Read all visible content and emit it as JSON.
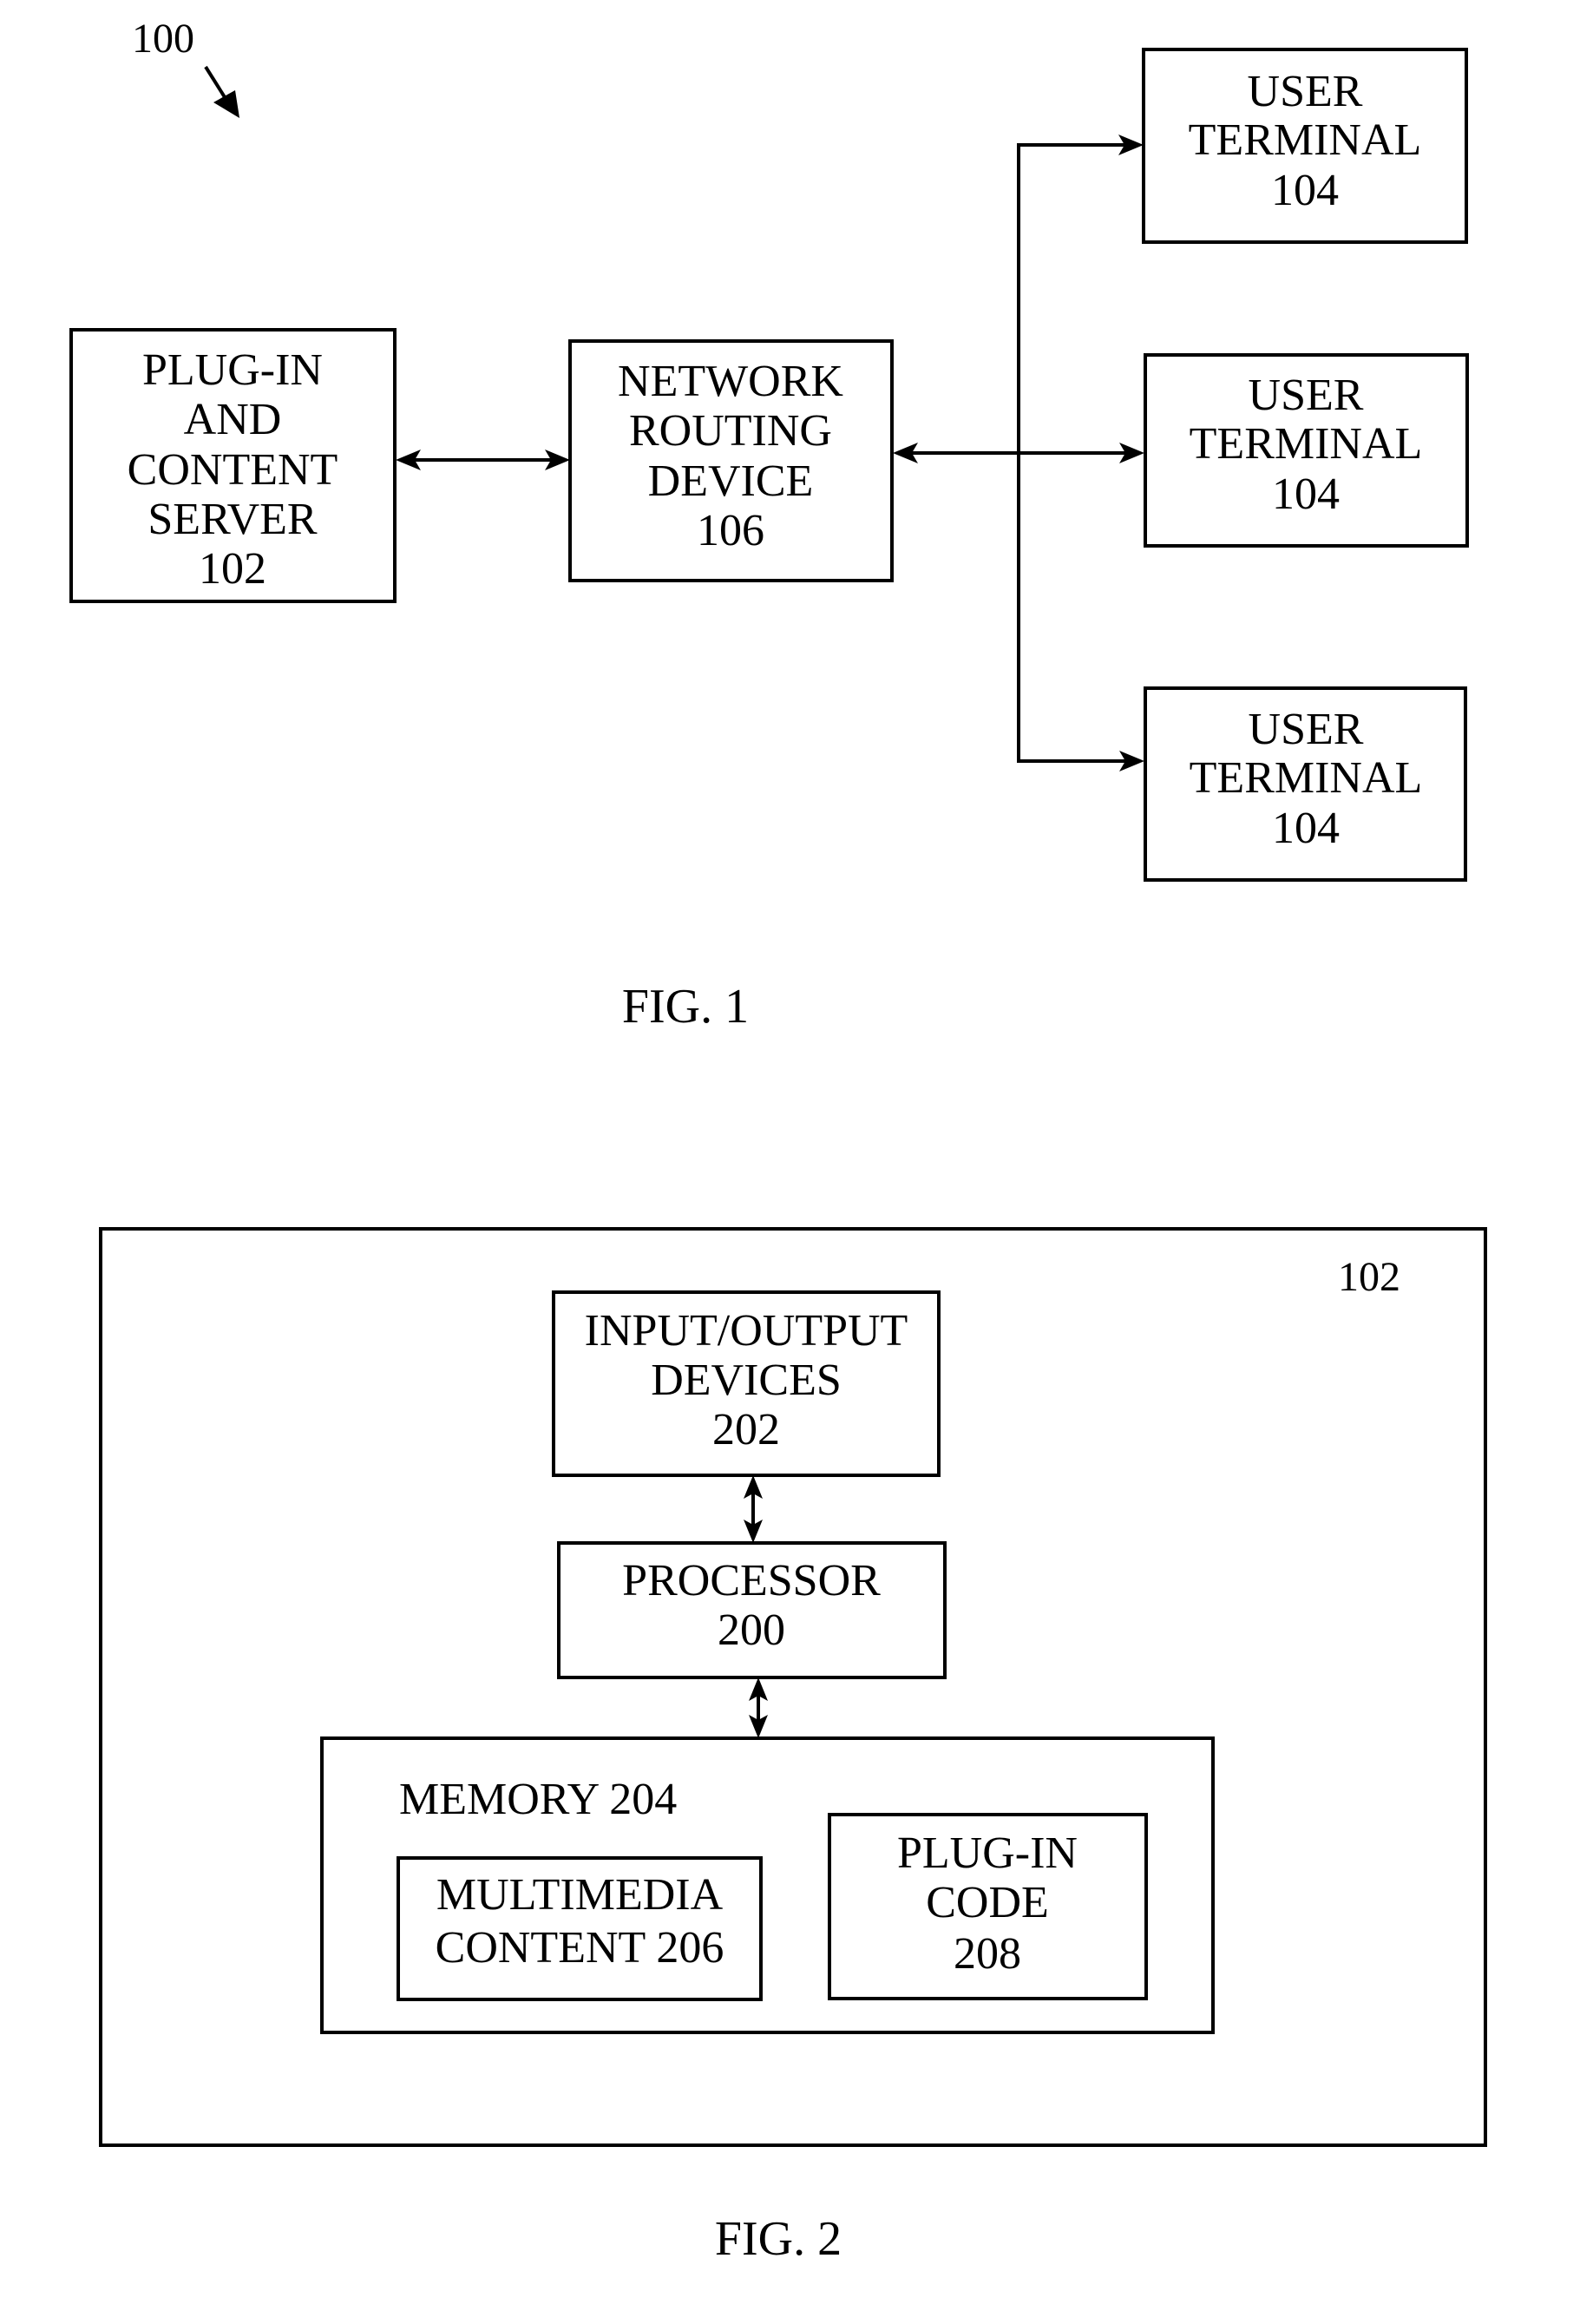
{
  "figure1": {
    "reference_label": "100",
    "caption": "FIG. 1",
    "server": {
      "lines": [
        "PLUG-IN",
        "AND",
        "CONTENT",
        "SERVER",
        "102"
      ]
    },
    "router": {
      "lines": [
        "NETWORK",
        "ROUTING",
        "DEVICE",
        "106"
      ]
    },
    "terminals": [
      {
        "lines": [
          "USER",
          "TERMINAL",
          "104"
        ]
      },
      {
        "lines": [
          "USER",
          "TERMINAL",
          "104"
        ]
      },
      {
        "lines": [
          "USER",
          "TERMINAL",
          "104"
        ]
      }
    ],
    "connections": [
      {
        "from": "server",
        "to": "router",
        "type": "bidirectional"
      },
      {
        "from": "router",
        "to": "terminals",
        "type": "bidirectional-branch"
      }
    ]
  },
  "figure2": {
    "caption": "FIG. 2",
    "container_label": "102",
    "io_devices": {
      "lines": [
        "INPUT/OUTPUT",
        "DEVICES",
        "202"
      ]
    },
    "processor": {
      "lines": [
        "PROCESSOR",
        "200"
      ]
    },
    "memory": {
      "label": "MEMORY 204",
      "multimedia": {
        "lines": [
          "MULTIMEDIA",
          "CONTENT 206"
        ]
      },
      "plugin_code": {
        "lines": [
          "PLUG-IN",
          "CODE",
          "208"
        ]
      }
    },
    "connections": [
      {
        "from": "io_devices",
        "to": "processor",
        "type": "bidirectional"
      },
      {
        "from": "processor",
        "to": "memory",
        "type": "bidirectional"
      }
    ]
  }
}
